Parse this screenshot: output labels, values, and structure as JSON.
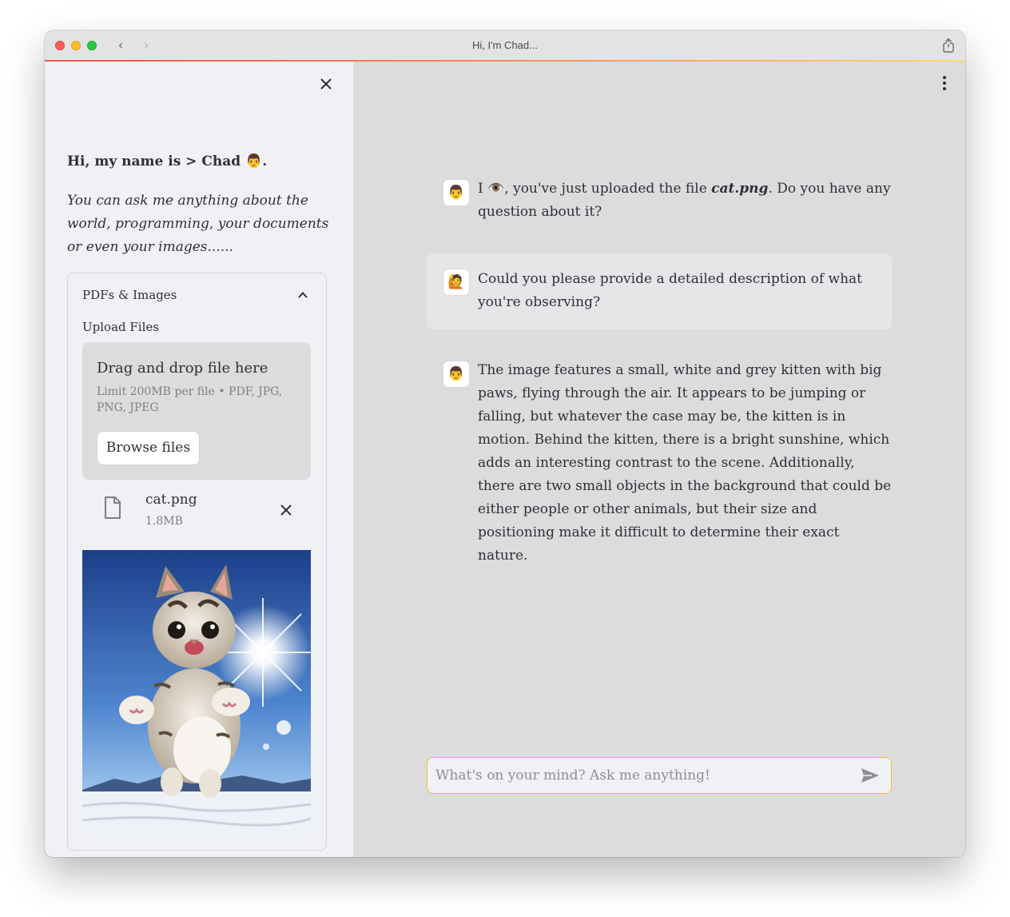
{
  "window": {
    "title": "Hi, I'm Chad..."
  },
  "sidebar": {
    "greeting": "Hi, my name is > Chad 👨.",
    "intro": "You can ask me anything about the world, programming, your documents or even your images......",
    "expander": {
      "title": "PDFs & Images",
      "upload_label": "Upload Files",
      "dropzone": {
        "title": "Drag and drop file here",
        "limit": "Limit 200MB per file • PDF, JPG, PNG, JPEG",
        "browse_label": "Browse files"
      },
      "file": {
        "name": "cat.png",
        "size": "1.8MB"
      }
    }
  },
  "chat": {
    "messages": [
      {
        "role": "assistant",
        "avatar": "👨",
        "pre": "I 👁️, you've just uploaded the file ",
        "file": "cat.png",
        "post": ". Do you have any question about it?"
      },
      {
        "role": "user",
        "avatar": "🙋",
        "text": "Could you please provide a detailed description of what you're observing?"
      },
      {
        "role": "assistant",
        "avatar": "👨",
        "text": "The image features a small, white and grey kitten with big paws, flying through the air. It appears to be jumping or falling, but whatever the case may be, the kitten is in motion. Behind the kitten, there is a bright sunshine, which adds an interesting contrast to the scene. Additionally, there are two small objects in the background that could be either people or other animals, but their size and positioning make it difficult to determine their exact nature."
      }
    ],
    "input": {
      "placeholder": "What's on your mind? Ask me anything!",
      "value": ""
    }
  },
  "colors": {
    "accent_border": "#f2b84b",
    "sidebar_bg": "#f0f1f4",
    "main_bg": "#dcdcdd"
  },
  "icons": [
    "close-icon",
    "chevron-up-icon",
    "file-icon",
    "send-icon",
    "kebab-menu-icon",
    "share-icon",
    "back-icon",
    "forward-icon"
  ]
}
